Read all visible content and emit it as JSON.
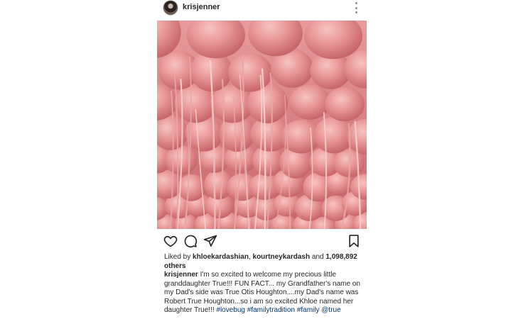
{
  "post": {
    "username": "krisjenner",
    "avatar_icon": "user-avatar",
    "more_icon": "more-vertical-icon"
  },
  "image": {
    "subject": "pink balloons",
    "colors": {
      "base": "#d7787d",
      "highlight": "#f3b2b2",
      "shadow": "#b9575c"
    }
  },
  "actions": {
    "like_icon": "heart-icon",
    "comment_icon": "comment-icon",
    "share_icon": "paper-plane-icon",
    "save_icon": "bookmark-icon"
  },
  "likes": {
    "prefix": "Liked by ",
    "user1": "khloekardashian",
    "sep": ", ",
    "user2": "kourtneykardash",
    "and": " and ",
    "count": "1,098,892 others"
  },
  "caption": {
    "username": "krisjenner",
    "text": " I'm so excited to welcome my precious little granddaughter True!!! FUN FACT... my Grandfather's name on my Dad's side was True Otis Houghton....my Dad's name was Robert True Houghton...so i am so excited Khloe named her daughter True!!! ",
    "hashtags": [
      "#lovebug",
      "#familytradition",
      "#family",
      "@true"
    ]
  },
  "colors": {
    "text": "#262626",
    "link": "#003569",
    "icon": "#262626"
  }
}
